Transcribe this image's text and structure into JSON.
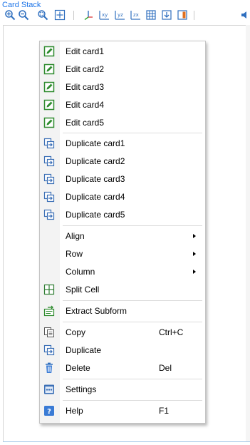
{
  "window": {
    "title": "Card Stack"
  },
  "toolbar": {
    "buttons": [
      {
        "name": "zoom-in-icon"
      },
      {
        "name": "zoom-out-icon"
      },
      {
        "name": "zoom-box-icon"
      },
      {
        "name": "zoom-extents-icon"
      },
      {
        "name": "axis-icon"
      },
      {
        "name": "xy-view-icon"
      },
      {
        "name": "yz-view-icon"
      },
      {
        "name": "zx-view-icon"
      },
      {
        "name": "table-icon"
      },
      {
        "name": "download-icon"
      },
      {
        "name": "panel-icon"
      },
      {
        "name": "speaker-icon"
      }
    ]
  },
  "menu": {
    "items": [
      {
        "label": "Edit card1",
        "icon": "edit-icon"
      },
      {
        "label": "Edit card2",
        "icon": "edit-icon"
      },
      {
        "label": "Edit card3",
        "icon": "edit-icon"
      },
      {
        "label": "Edit card4",
        "icon": "edit-icon"
      },
      {
        "label": "Edit card5",
        "icon": "edit-icon"
      },
      {
        "label": "Duplicate card1",
        "icon": "duplicate-icon"
      },
      {
        "label": "Duplicate card2",
        "icon": "duplicate-icon"
      },
      {
        "label": "Duplicate card3",
        "icon": "duplicate-icon"
      },
      {
        "label": "Duplicate card4",
        "icon": "duplicate-icon"
      },
      {
        "label": "Duplicate card5",
        "icon": "duplicate-icon"
      },
      {
        "label": "Align",
        "submenu": true
      },
      {
        "label": "Row",
        "submenu": true
      },
      {
        "label": "Column",
        "submenu": true
      },
      {
        "label": "Split Cell",
        "icon": "split-cell-icon"
      },
      {
        "label": "Extract Subform",
        "icon": "extract-subform-icon"
      },
      {
        "label": "Copy",
        "icon": "copy-icon",
        "shortcut": "Ctrl+C"
      },
      {
        "label": "Duplicate",
        "icon": "duplicate-icon"
      },
      {
        "label": "Delete",
        "icon": "delete-icon",
        "shortcut": "Del"
      },
      {
        "label": "Settings",
        "icon": "settings-icon"
      },
      {
        "label": "Help",
        "icon": "help-icon",
        "shortcut": "F1"
      }
    ]
  },
  "colors": {
    "title": "#1a73e8",
    "edit_green": "#2e8b2e",
    "duplicate_blue": "#3b6fb6",
    "help_blue": "#3a7bd5",
    "toolbar_blue": "#2f6fbf"
  }
}
